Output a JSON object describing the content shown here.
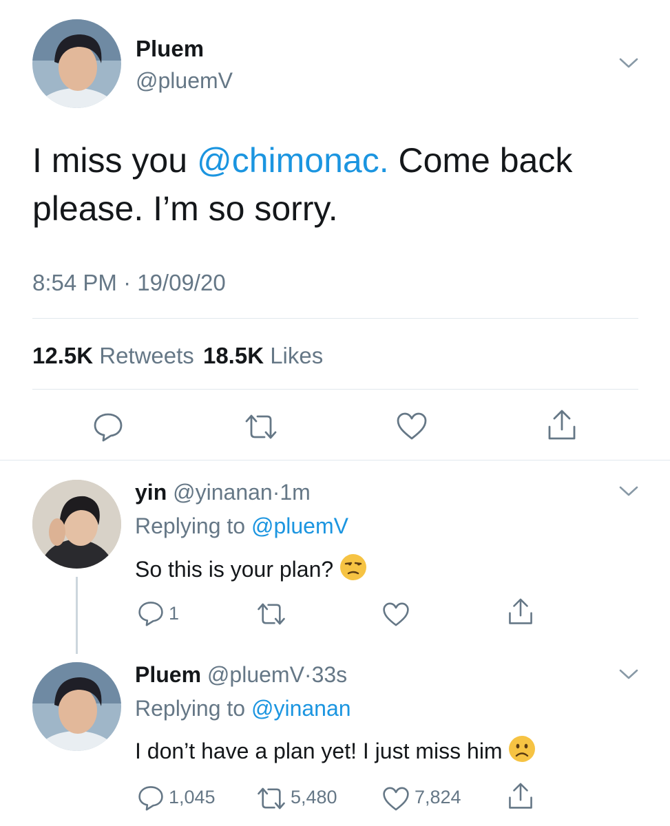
{
  "main_tweet": {
    "name": "Pluem",
    "handle": "@pluemV",
    "text_before": "I miss you ",
    "mention": "@chimonac.",
    "text_after": " Come back please. I’m so sorry.",
    "timestamp": "8:54 PM · 19/09/20",
    "retweets_count": "12.5K",
    "retweets_label": "Retweets",
    "likes_count": "18.5K",
    "likes_label": "Likes"
  },
  "replies": [
    {
      "name": "yin",
      "handle": "@yinanan",
      "sep": "·",
      "time": "1m",
      "replying_label": "Replying to ",
      "replying_to": "@pluemV",
      "text": "So this is your plan? ",
      "emoji": "😒",
      "reply_count": "1",
      "retweet_count": "",
      "like_count": ""
    },
    {
      "name": "Pluem",
      "handle": "@pluemV",
      "sep": "·",
      "time": "33s",
      "replying_label": "Replying to ",
      "replying_to": "@yinanan",
      "text": "I don’t have a plan yet! I just miss him ",
      "emoji": "☹️",
      "reply_count": "1,045",
      "retweet_count": "5,480",
      "like_count": "7,824"
    }
  ],
  "colors": {
    "link": "#1b95e0",
    "secondary": "#657786",
    "divider": "#e1e8ed",
    "emoji": "#f6c343"
  },
  "icons": [
    "chevron-down-icon",
    "reply-icon",
    "retweet-icon",
    "heart-icon",
    "share-icon"
  ]
}
